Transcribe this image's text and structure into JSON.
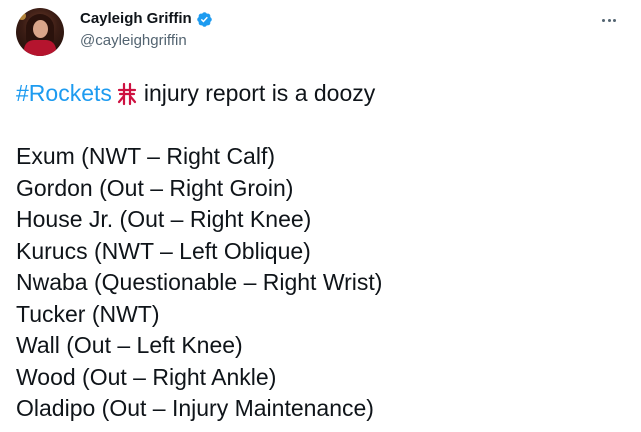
{
  "author": {
    "display_name": "Cayleigh Griffin",
    "handle": "@cayleighgriffin",
    "verified": true,
    "avatar_icon": "profile-photo"
  },
  "menu": {
    "icon": "more-options-icon"
  },
  "tweet": {
    "hashtag": "#Rockets",
    "team_emoji_icon": "houston-rockets-logo-icon",
    "intro_text": "injury report is a doozy",
    "lines": [
      "Exum (NWT – Right Calf)",
      "Gordon (Out – Right Groin)",
      "House Jr. (Out – Right Knee)",
      "Kurucs (NWT – Left Oblique)",
      "Nwaba (Questionable – Right Wrist)",
      "Tucker (NWT)",
      "Wall (Out – Left Knee)",
      "Wood (Out – Right Ankle)",
      "Oladipo (Out – Injury Maintenance)"
    ]
  },
  "colors": {
    "link": "#1d9bf0",
    "text": "#0f1419",
    "secondary": "#536471",
    "rockets_red": "#ce1141"
  }
}
